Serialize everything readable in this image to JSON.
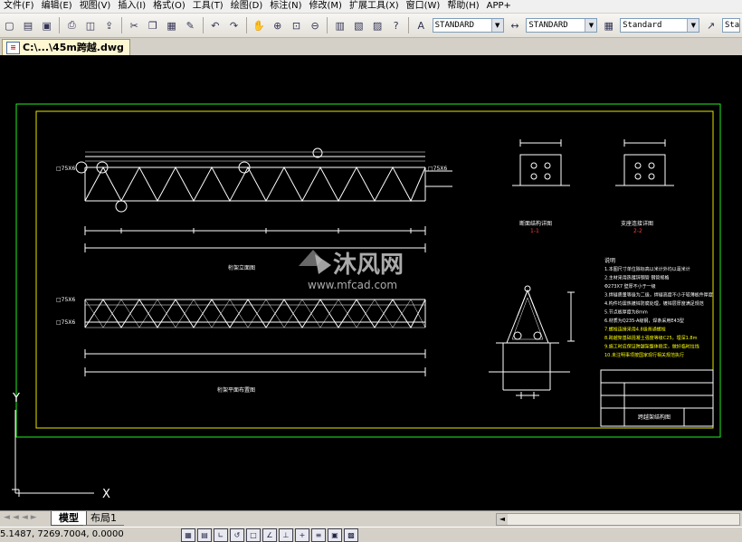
{
  "menu": [
    "文件(F)",
    "编辑(E)",
    "视图(V)",
    "插入(I)",
    "格式(O)",
    "工具(T)",
    "绘图(D)",
    "标注(N)",
    "修改(M)",
    "扩展工具(X)",
    "窗口(W)",
    "帮助(H)",
    "APP+"
  ],
  "toolbar": {
    "text_style": "STANDARD",
    "dim_style": "STANDARD",
    "table_style": "Standard",
    "multileader_style": "Sta"
  },
  "document_tab": {
    "label": "C:\\...\\45m跨越.dwg"
  },
  "layout_tabs": {
    "model": "模型",
    "layout1": "布局1"
  },
  "status": {
    "coordinates": "5.1487, 7269.7004, 0.0000"
  },
  "drawing": {
    "ucs": {
      "y": "Y",
      "x": "X"
    },
    "watermark": {
      "brand": "沐风网",
      "url": "www.mfcad.com"
    },
    "labels": {
      "member_1": "□75X6",
      "member_2": "□75X6",
      "member_3": "□75X6",
      "member_4": "□75X6",
      "elev_title": "桁架立面图",
      "plan_title": "桁架平面布置图",
      "section_1": "1-1",
      "section_2": "2-2",
      "notes_title": "说明",
      "title_block": "跨越架结构图"
    },
    "notes": [
      "1.本图尺寸单位除标高以米计外均以毫米计",
      "2.主材采用热镀锌钢管  钢管规格",
      "  Φ273X7 壁厚不小于一级",
      "3.焊缝质量等级为二级，焊缝高度不小于较薄板件厚度",
      "4.构件均需热镀锌防腐处理，镀锌层厚度满足规范",
      "5.节点板厚度为8mm",
      "6.材质为Q235-A级钢，焊条采用E43型",
      "7.螺栓连接采用4.8级普通螺栓",
      "8.跨越架基础混凝土强度等级C25，埋深1.8m",
      "9.施工时应保证跨越架整体稳定，做好临时拉线",
      "10.未注明事项按国家现行相关规范执行"
    ]
  },
  "colors": {
    "canvas": "#000000",
    "border_green": "#22ee22",
    "border_yellow": "#e6e600",
    "line_white": "#ffffff",
    "notes_yellow": "#ffff00",
    "section_red": "#ff3b3b"
  }
}
